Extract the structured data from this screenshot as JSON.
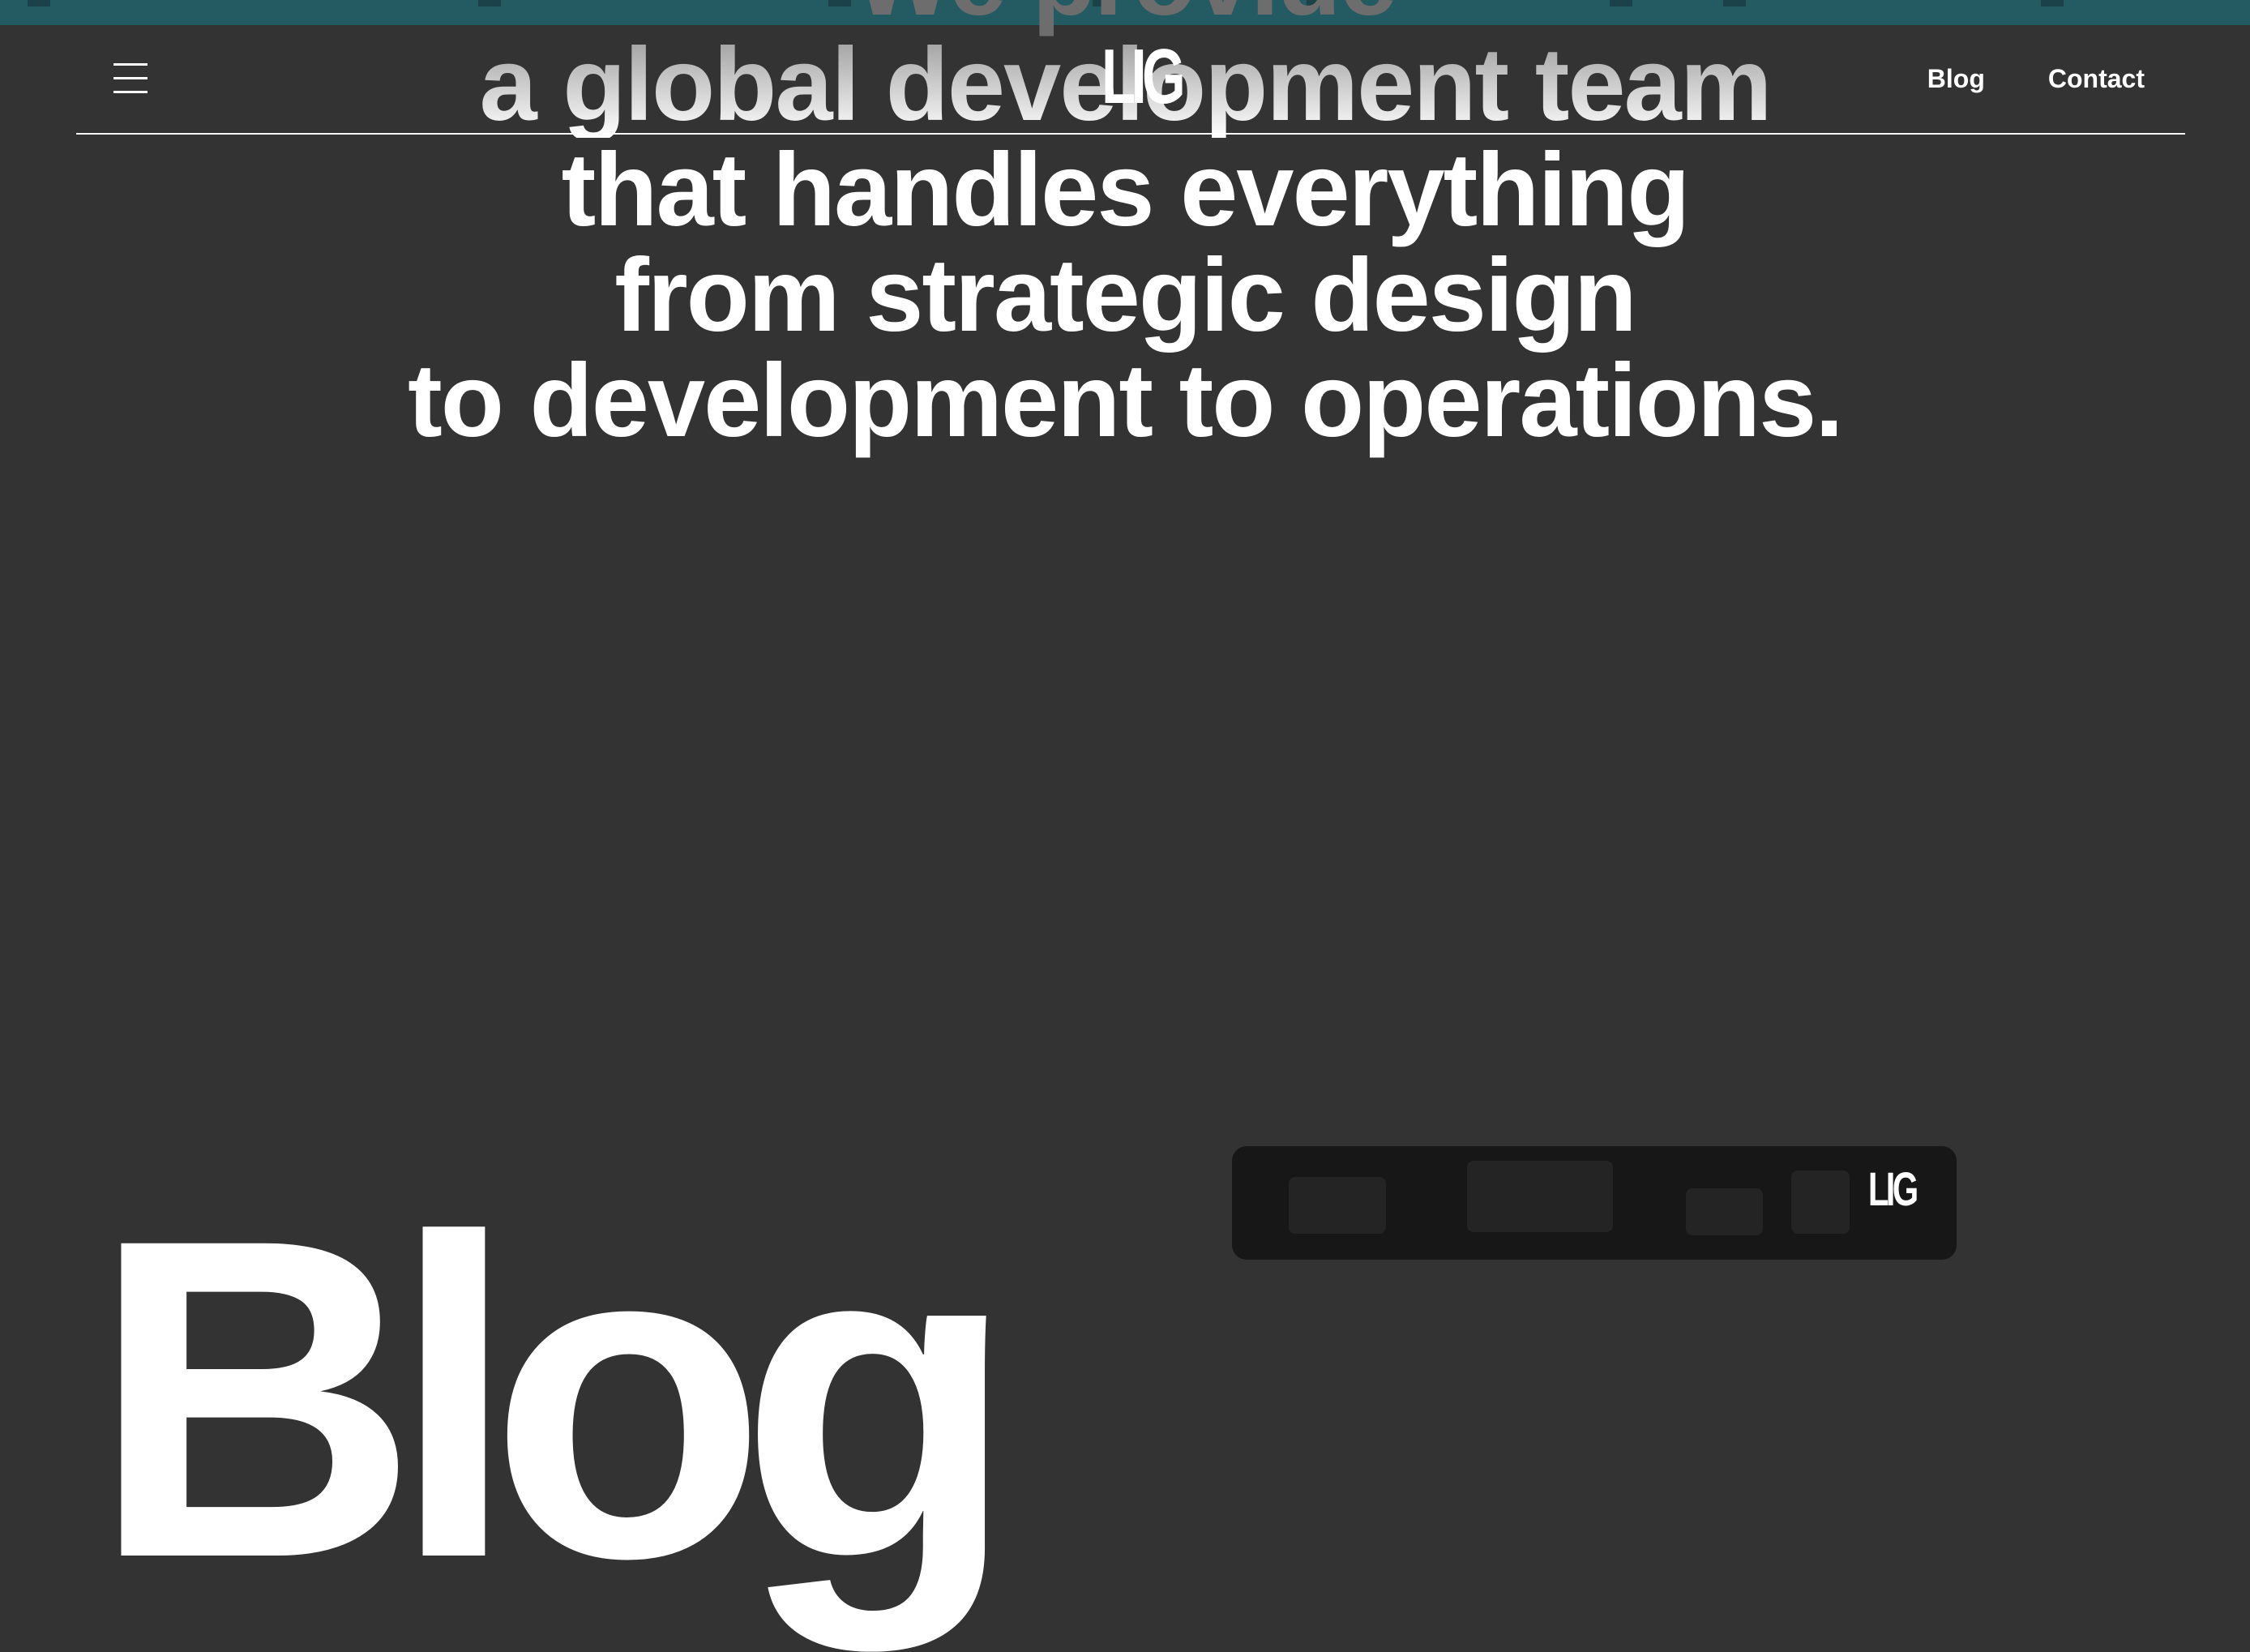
{
  "header": {
    "logo": "LIG",
    "nav": [
      {
        "label": "Blog"
      },
      {
        "label": "Contact"
      }
    ]
  },
  "hero": {
    "lines": [
      "We provide",
      "a global development team",
      "that handles everything",
      "from strategic design",
      "to development to operations."
    ]
  },
  "blog": {
    "heading": "Blog",
    "card_logo": "LIG"
  },
  "colors": {
    "background": "#333333",
    "browser_strip": "#245a62",
    "text": "#ffffff"
  },
  "icons": {
    "menu": "hamburger-menu-icon"
  }
}
